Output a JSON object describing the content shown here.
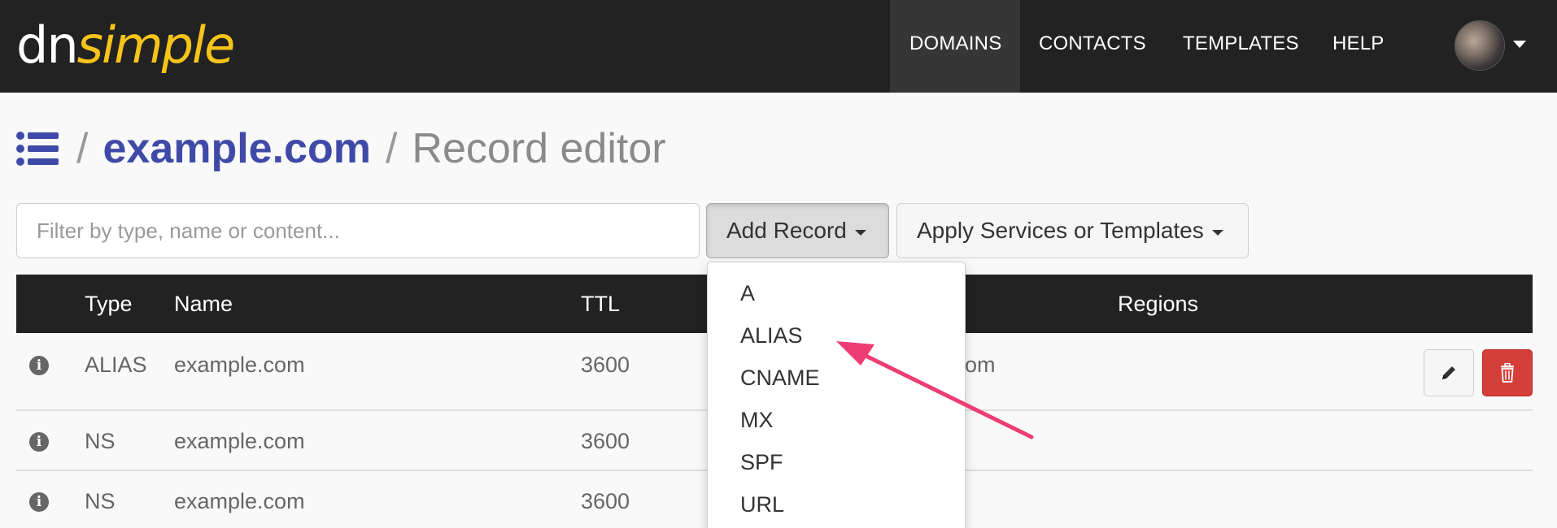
{
  "logo": {
    "part1": "dn",
    "part2": "simple"
  },
  "nav": {
    "items": [
      "DOMAINS",
      "CONTACTS",
      "TEMPLATES",
      "HELP"
    ]
  },
  "breadcrumb": {
    "separator": "/",
    "domain": "example.com",
    "current": "Record editor"
  },
  "filter": {
    "placeholder": "Filter by type, name or content...",
    "value": ""
  },
  "toolbar": {
    "add_record_label": "Add Record",
    "apply_label": "Apply Services or Templates"
  },
  "table": {
    "columns": {
      "type": "Type",
      "name": "Name",
      "ttl": "TTL",
      "regions": "Regions"
    },
    "rows": [
      {
        "type": "ALIAS",
        "name": "example.com",
        "ttl": "3600",
        "content_tail": "om"
      },
      {
        "type": "NS",
        "name": "example.com",
        "ttl": "3600",
        "content_tail": ""
      },
      {
        "type": "NS",
        "name": "example.com",
        "ttl": "3600",
        "content_tail": ""
      }
    ]
  },
  "add_record_menu": {
    "options": [
      "A",
      "ALIAS",
      "CNAME",
      "MX",
      "SPF",
      "URL"
    ]
  },
  "colors": {
    "navbar": "#222222",
    "brand_yellow": "#f6c419",
    "link_blue": "#3f4aa8",
    "danger": "#d43f3a",
    "annotation_arrow": "#ee3d73"
  }
}
